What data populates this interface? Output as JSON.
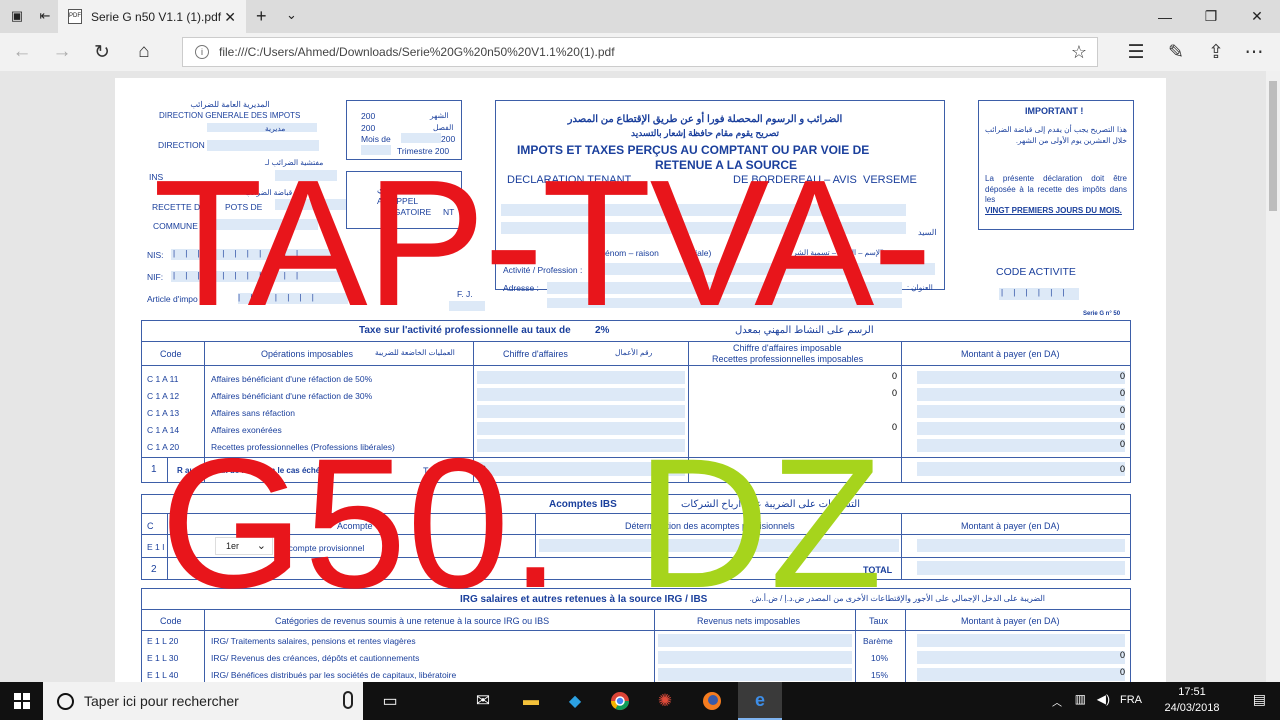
{
  "browser": {
    "tab_title": "Serie G n50 V1.1 (1).pdf",
    "tab_icon": "pdf-icon",
    "url": "file:///C:/Users/Ahmed/Downloads/Serie%20G%20n50%20V1.1%20(1).pdf"
  },
  "overlay": {
    "line1": "TAP-TVA-",
    "line2_red": "G50.",
    "line2_green": "DZ",
    "red_color": "#e8151b",
    "green_color": "#a6d41c"
  },
  "form": {
    "header_left": {
      "ar_direction": "المديرية العامة للضرائب",
      "direction_generale": "DIRECTION GENERALE DES IMPOTS",
      "ar_mudiriya": "مديرية",
      "direction": "DIRECTION",
      "ar_inspection": "مفتشية الضرائب لـ",
      "inspection": "INS",
      "ar_recette": "قباضة الضرائب",
      "recette": "RECETTE D",
      "impots_de": "POTS DE",
      "commune": "COMMUNE",
      "nis": "NIS:",
      "nif": "NIF:",
      "article": "Article d'impo",
      "fj": "F. J."
    },
    "period_box": {
      "ar_month": "الشهر",
      "year1": "200",
      "ar_quarter": "الفصل",
      "year2": "200",
      "mois_de": "Mois de",
      "val_mois": "200",
      "trimestre": "Trimestre 200",
      "ar_reminder": "تذكير إجباري",
      "rappeler": "A RAPPEL",
      "obligatoire": "BLIGATOIRE",
      "nt": "NT"
    },
    "title_box": {
      "ar_title": "الضرائب و الرسوم المحصلة فورا أو عن طريق الإقتطاع من المصدر",
      "ar_sub": "تصريح يقوم مقام حافظة إشعار بالتسديد",
      "title_l1": "IMPOTS ET TAXES PERÇUS AU COMPTANT OU PAR VOIE DE",
      "title_l2": "RETENUE A LA SOURCE",
      "declaration": "DECLARATION  TENANT",
      "bordereau": "DE BORDEREAU – AVIS",
      "versem": "VERSEME",
      "ar_sayed": "السيد",
      "nom": "énom – raison",
      "sociale": "ciale)",
      "ar_name": "(الإسم – اللقب – تسمية الشركة)",
      "activite": "Activité / Profession :",
      "adresse": "Adresse :",
      "ar_address": "العنوان :"
    },
    "important_box": {
      "title": "IMPORTANT !",
      "ar_text": "هذا التصريح يجب أن يقدم إلى قباضة الضرائب خلال العشرين يوم الأولى من الشهر.",
      "fr_text1": "La présente déclaration doit être déposée à la recette des impôts dans les",
      "fr_text2": "VINGT PREMIERS JOURS DU MOIS."
    },
    "code_activite": "CODE ACTIVITE",
    "serie_label": "Serie G n° 50",
    "section_tap": {
      "title": "Taxe sur l'activité professionnelle au taux de",
      "rate": "2%",
      "ar_title": "الرسم على النشاط المهني بمعدل",
      "headers": {
        "code": "Code",
        "operations": "Opérations imposables",
        "ar_operations": "العمليات الخاضعة للضريبة",
        "ca": "Chiffre d'affaires",
        "ar_ca": "رقم الأعمال",
        "ca_imposable_1": "Chiffre d'affaires imposable",
        "ca_imposable_2": "Recettes professionnelles imposables",
        "montant": "Montant à payer (en DA)"
      },
      "rows": [
        {
          "code": "C 1 A 11",
          "label": "Affaires bénéficiant d'une réfaction de 50%",
          "imposable": "0",
          "montant": "0"
        },
        {
          "code": "C 1 A 12",
          "label": "Affaires bénéficiant d'une réfaction de 30%",
          "imposable": "0",
          "montant": "0"
        },
        {
          "code": "C 1 A 13",
          "label": "Affaires sans réfaction",
          "imposable": "",
          "montant": "0"
        },
        {
          "code": "C 1 A 14",
          "label": "Affaires exonérées",
          "imposable": "0",
          "montant": "0"
        },
        {
          "code": "C 1 A 20",
          "label": "Recettes professionnelles (Professions libérales)",
          "imposable": "",
          "montant": "0"
        }
      ],
      "total_row": {
        "num": "1",
        "label": "R  autres taux de réfaction le cas échéant",
        "to": "TO",
        "val1": "0",
        "val2": "0"
      }
    },
    "section_ibs": {
      "title": "Acomptes IBS",
      "ar_title": "التسبيقات على الضريبة على أرباح الشركات",
      "code_col": "C",
      "acompte_col": "Acompte",
      "determination": "Détermination des acomptes provisionnels",
      "montant": "Montant à payer (en DA)",
      "row_code": "E 1 I",
      "dropdown_value": "1er",
      "row_label": "Acompte provisionnel",
      "total_num": "2",
      "total_label": "TOTAL"
    },
    "section_irg": {
      "title": "IRG salaires et autres retenues à la source IRG / IBS",
      "ar_title": "الضريبة على الدخل الإجمالي على الأجور والإقتطاعات الأخرى من المصدر ض.د.إ / ض.أ.ش.",
      "headers": {
        "code": "Code",
        "categories": "Catégories de revenus soumis à une retenue à la source IRG ou IBS",
        "revenus": "Revenus nets imposables",
        "taux": "Taux",
        "montant": "Montant à payer (en DA)"
      },
      "rows": [
        {
          "code": "E 1 L 20",
          "label": "IRG/ Traitements salaires, pensions et rentes viagères",
          "taux": "Barème",
          "montant": ""
        },
        {
          "code": "E 1 L 30",
          "label": "IRG/ Revenus des créances, dépôts et cautionnements",
          "taux": "10%",
          "montant": "0"
        },
        {
          "code": "E 1 L 40",
          "label": "IRG/ Bénéfices distribués par les sociétés de capitaux, libératoire",
          "taux": "15%",
          "montant": "0"
        }
      ]
    }
  },
  "taskbar": {
    "search_placeholder": "Taper ici pour rechercher",
    "language": "FRA",
    "time": "17:51",
    "date": "24/03/2018"
  }
}
